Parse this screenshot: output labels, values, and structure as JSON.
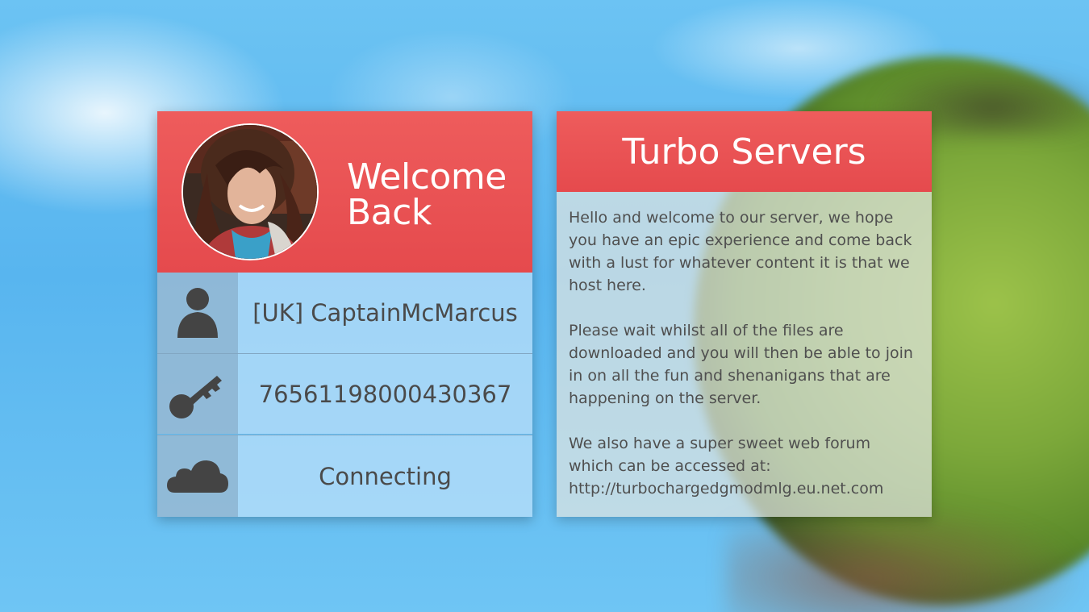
{
  "welcome": {
    "title_line1": "Welcome",
    "title_line2": "Back",
    "avatar": "user-avatar-photo"
  },
  "player": {
    "name": "[UK] CaptainMcMarcus",
    "steam_id": "76561198000430367",
    "status": "Connecting"
  },
  "icons": {
    "name": "person-icon",
    "id": "key-icon",
    "status": "cloud-icon"
  },
  "server": {
    "title": "Turbo Servers",
    "paragraph1": "Hello and welcome to our server, we hope you have an epic experience and come back with a lust for whatever content it is that we host here.",
    "paragraph2": "Please wait whilst all of the files are downloaded and you will then be able to join in on all the fun and shenanigans that are happening on the server.",
    "paragraph3_line1": "We also have a super sweet web forum which can be accessed at:",
    "forum_url": "http://turbochargedgmodmlg.eu.net.com"
  },
  "colors": {
    "accent": "#e8524f",
    "text_dark": "#4a4a4a",
    "icon_gray": "#444444"
  }
}
